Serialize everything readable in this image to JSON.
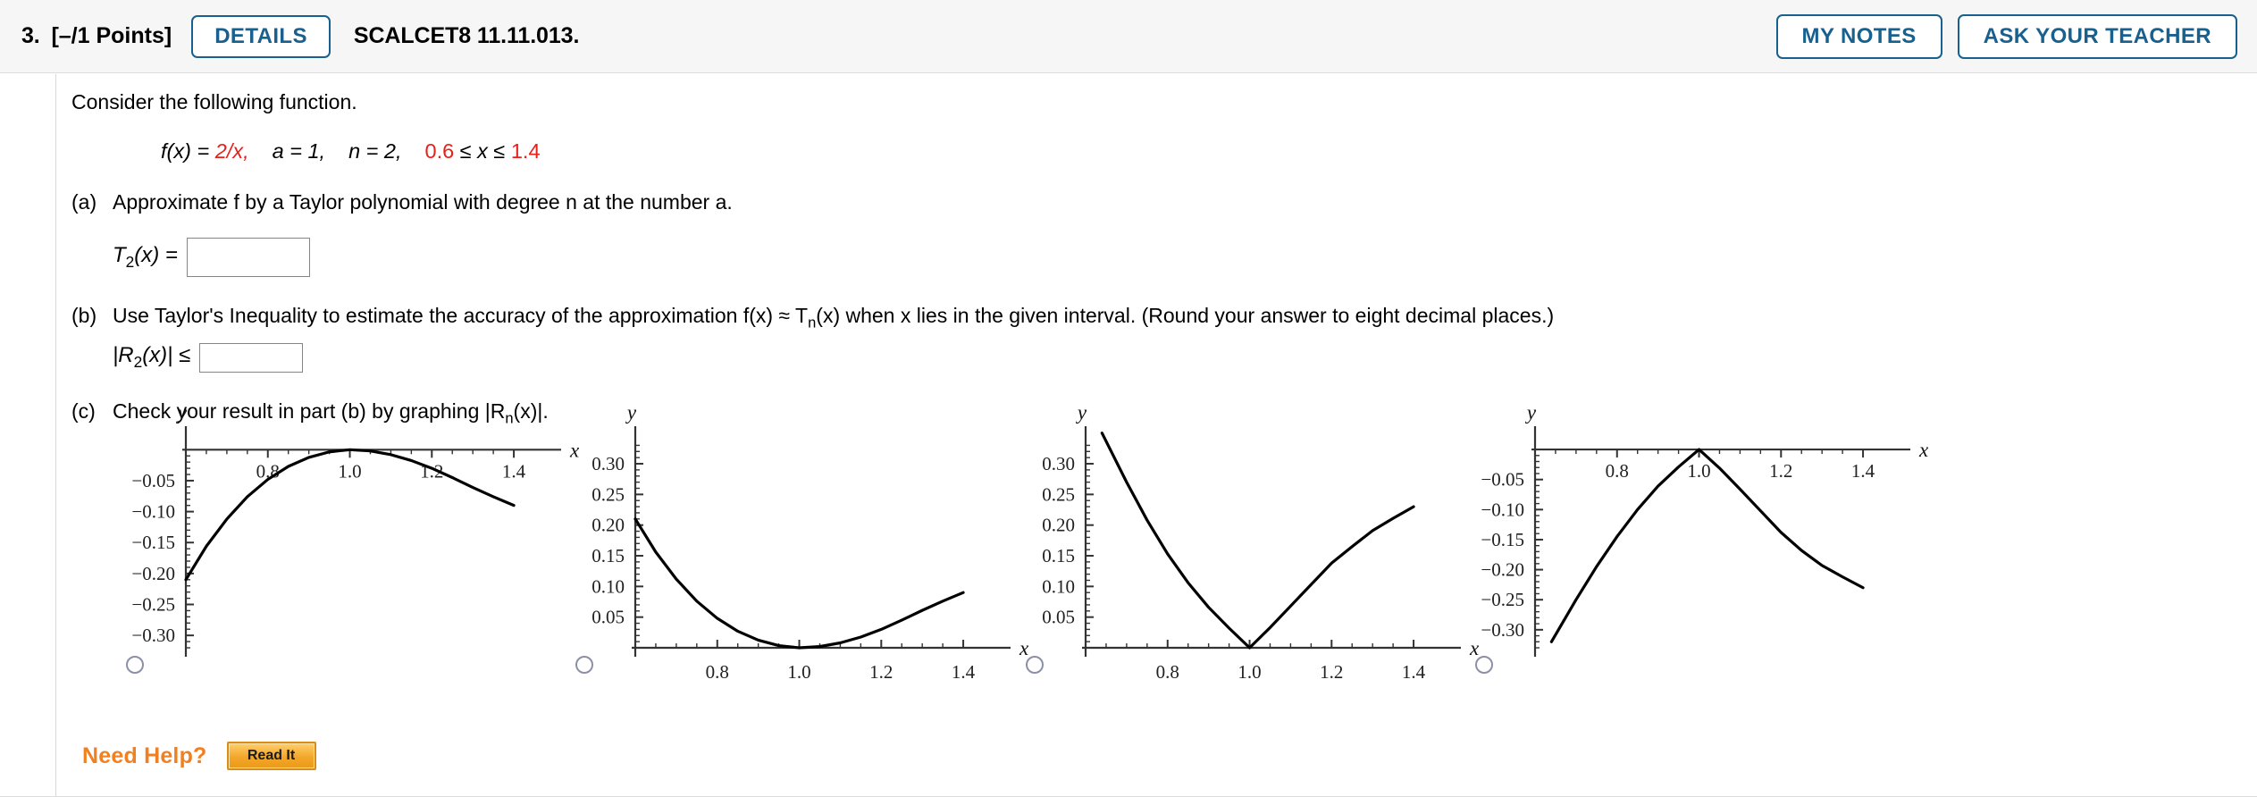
{
  "header": {
    "question_number": "3.",
    "points": "[–/1 Points]",
    "details_label": "DETAILS",
    "problem_code": "SCALCET8 11.11.013.",
    "my_notes_label": "MY NOTES",
    "ask_teacher_label": "ASK YOUR TEACHER"
  },
  "prompt": {
    "intro": "Consider the following function.",
    "formula": {
      "f_of_x": "f(x) = ",
      "f_value": "2/x,",
      "a": "a = 1,",
      "n": "n = 2,",
      "interval_low": "0.6",
      "interval_mid": " ≤ x ≤ ",
      "interval_high": "1.4"
    }
  },
  "parts": {
    "a": {
      "label": "(a)",
      "text": "Approximate f by a Taylor polynomial with degree n at the number a.",
      "answer_label_t": "T",
      "answer_label_sub": "2",
      "answer_label_rest": "(x) =",
      "answer_value": "",
      "answer_placeholder": ""
    },
    "b": {
      "label": "(b)",
      "text": "Use Taylor's Inequality to estimate the accuracy of the approximation f(x) ≈ T",
      "text_sub": "n",
      "text_rest": "(x) when x lies in the given interval. (Round your answer to eight decimal places.)",
      "answer_label_pre": "|R",
      "answer_label_sub": "2",
      "answer_label_rest": "(x)| ≤",
      "answer_value": "",
      "answer_placeholder": ""
    },
    "c": {
      "label": "(c)",
      "text_pre": "Check your result in part (b) by graphing |R",
      "text_sub": "n",
      "text_rest": "(x)|."
    }
  },
  "need_help": {
    "label": "Need Help?",
    "read_it_label": "Read It"
  },
  "chart_data": [
    {
      "id": "choice-1",
      "type": "line",
      "title": "",
      "xlabel": "x",
      "ylabel": "y",
      "xlim": [
        0.6,
        1.45
      ],
      "ylim": [
        -0.32,
        0.012
      ],
      "xticks": [
        0.8,
        1.0,
        1.2,
        1.4
      ],
      "xtick_labels": [
        "0.8",
        "1.0",
        "1.2",
        "1.4"
      ],
      "yticks": [
        -0.05,
        -0.1,
        -0.15,
        -0.2,
        -0.25,
        -0.3
      ],
      "ytick_labels": [
        "−0.05",
        "−0.10",
        "−0.15",
        "−0.20",
        "−0.25",
        "−0.30"
      ],
      "grid": false,
      "x": [
        0.6,
        0.65,
        0.7,
        0.75,
        0.8,
        0.85,
        0.9,
        0.95,
        1.0,
        1.05,
        1.1,
        1.15,
        1.2,
        1.25,
        1.3,
        1.35,
        1.4
      ],
      "values": [
        -0.21,
        -0.156,
        -0.112,
        -0.076,
        -0.048,
        -0.027,
        -0.0125,
        -0.0035,
        0.0,
        -0.002,
        -0.008,
        -0.0175,
        -0.03,
        -0.045,
        -0.061,
        -0.076,
        -0.09
      ]
    },
    {
      "id": "choice-2",
      "type": "line",
      "title": "",
      "xlabel": "x",
      "ylabel": "y",
      "xlim": [
        0.6,
        1.45
      ],
      "ylim": [
        0,
        0.335
      ],
      "xticks": [
        0.8,
        1.0,
        1.2,
        1.4
      ],
      "xtick_labels": [
        "0.8",
        "1.0",
        "1.2",
        "1.4"
      ],
      "yticks": [
        0.05,
        0.1,
        0.15,
        0.2,
        0.25,
        0.3
      ],
      "ytick_labels": [
        "0.05",
        "0.10",
        "0.15",
        "0.20",
        "0.25",
        "0.30"
      ],
      "grid": false,
      "x": [
        0.6,
        0.65,
        0.7,
        0.75,
        0.8,
        0.85,
        0.9,
        0.95,
        1.0,
        1.05,
        1.1,
        1.15,
        1.2,
        1.25,
        1.3,
        1.35,
        1.4
      ],
      "values": [
        0.21,
        0.156,
        0.112,
        0.076,
        0.048,
        0.027,
        0.0125,
        0.0035,
        0.0,
        0.002,
        0.008,
        0.0175,
        0.03,
        0.045,
        0.061,
        0.076,
        0.09
      ]
    },
    {
      "id": "choice-3",
      "type": "line",
      "title": "",
      "xlabel": "x",
      "ylabel": "y",
      "xlim": [
        0.6,
        1.45
      ],
      "ylim": [
        0,
        0.335
      ],
      "xticks": [
        0.8,
        1.0,
        1.2,
        1.4
      ],
      "xtick_labels": [
        "0.8",
        "1.0",
        "1.2",
        "1.4"
      ],
      "yticks": [
        0.05,
        0.1,
        0.15,
        0.2,
        0.25,
        0.3
      ],
      "ytick_labels": [
        "0.05",
        "0.10",
        "0.15",
        "0.20",
        "0.25",
        "0.30"
      ],
      "grid": false,
      "x": [
        0.64,
        0.7,
        0.75,
        0.8,
        0.85,
        0.9,
        0.95,
        1.0,
        1.05,
        1.1,
        1.15,
        1.2,
        1.25,
        1.3,
        1.35,
        1.4
      ],
      "values": [
        0.35,
        0.27,
        0.208,
        0.153,
        0.106,
        0.066,
        0.032,
        0.0,
        0.033,
        0.068,
        0.103,
        0.138,
        0.165,
        0.191,
        0.211,
        0.23
      ]
    },
    {
      "id": "choice-4",
      "type": "line",
      "title": "",
      "xlabel": "x",
      "ylabel": "y",
      "xlim": [
        0.6,
        1.45
      ],
      "ylim": [
        -0.33,
        0.012
      ],
      "xticks": [
        0.8,
        1.0,
        1.2,
        1.4
      ],
      "xtick_labels": [
        "0.8",
        "1.0",
        "1.2",
        "1.4"
      ],
      "yticks": [
        -0.05,
        -0.1,
        -0.15,
        -0.2,
        -0.25,
        -0.3
      ],
      "ytick_labels": [
        "−0.05",
        "−0.10",
        "−0.15",
        "−0.20",
        "−0.25",
        "−0.30"
      ],
      "grid": false,
      "x": [
        0.64,
        0.7,
        0.75,
        0.8,
        0.85,
        0.9,
        0.95,
        1.0,
        1.05,
        1.1,
        1.15,
        1.2,
        1.25,
        1.3,
        1.35,
        1.4
      ],
      "values": [
        -0.32,
        -0.25,
        -0.195,
        -0.145,
        -0.1,
        -0.061,
        -0.029,
        0.0,
        -0.031,
        -0.066,
        -0.102,
        -0.138,
        -0.168,
        -0.193,
        -0.212,
        -0.23
      ]
    }
  ],
  "colors": {
    "accent_blue": "#18608e",
    "red": "#e8201a",
    "orange": "#f08020",
    "curve": "#000000"
  }
}
